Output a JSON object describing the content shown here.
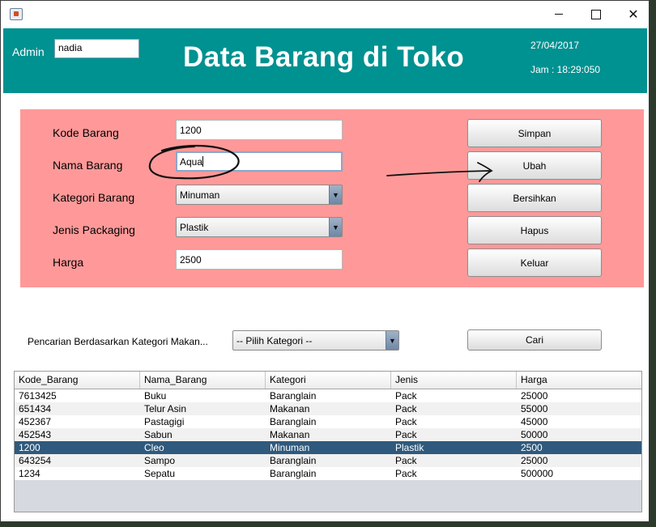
{
  "window": {
    "icon": "java-cup-icon",
    "controls": {
      "minimize": "minimize-icon",
      "maximize": "maximize-icon",
      "close": "✕"
    }
  },
  "header": {
    "admin_label": "Admin",
    "admin_value": "nadia",
    "title": "Data Barang di Toko",
    "date": "27/04/2017",
    "time": "Jam : 18:29:050",
    "color": "#009191"
  },
  "form": {
    "panel_color": "#ff9999",
    "fields": {
      "kode": {
        "label": "Kode Barang",
        "value": "1200"
      },
      "nama": {
        "label": "Nama Barang",
        "value": "Aqua"
      },
      "kategori": {
        "label": "Kategori Barang",
        "value": "Minuman"
      },
      "jenis": {
        "label": "Jenis Packaging",
        "value": "Plastik"
      },
      "harga": {
        "label": "Harga",
        "value": "2500"
      }
    },
    "buttons": {
      "simpan": "Simpan",
      "ubah": "Ubah",
      "bersihkan": "Bersihkan",
      "hapus": "Hapus",
      "keluar": "Keluar"
    }
  },
  "search": {
    "label": "Pencarian Berdasarkan Kategori Makan...",
    "category_value": "-- Pilih Kategori --",
    "button": "Cari"
  },
  "table": {
    "columns": [
      "Kode_Barang",
      "Nama_Barang",
      "Kategori",
      "Jenis",
      "Harga"
    ],
    "rows": [
      [
        "7613425",
        "Buku",
        "Baranglain",
        "Pack",
        "25000"
      ],
      [
        "651434",
        "Telur Asin",
        "Makanan",
        "Pack",
        "55000"
      ],
      [
        "452367",
        "Pastagigi",
        "Baranglain",
        "Pack",
        "45000"
      ],
      [
        "452543",
        "Sabun",
        "Makanan",
        "Pack",
        "50000"
      ],
      [
        "1200",
        "Cleo",
        "Minuman",
        "Plastik",
        "2500"
      ],
      [
        "643254",
        "Sampo",
        "Baranglain",
        "Pack",
        "25000"
      ],
      [
        "1234",
        "Sepatu",
        "Baranglain",
        "Pack",
        "500000"
      ]
    ],
    "selected_row": 4,
    "selected_color": "#2f5a7d"
  }
}
